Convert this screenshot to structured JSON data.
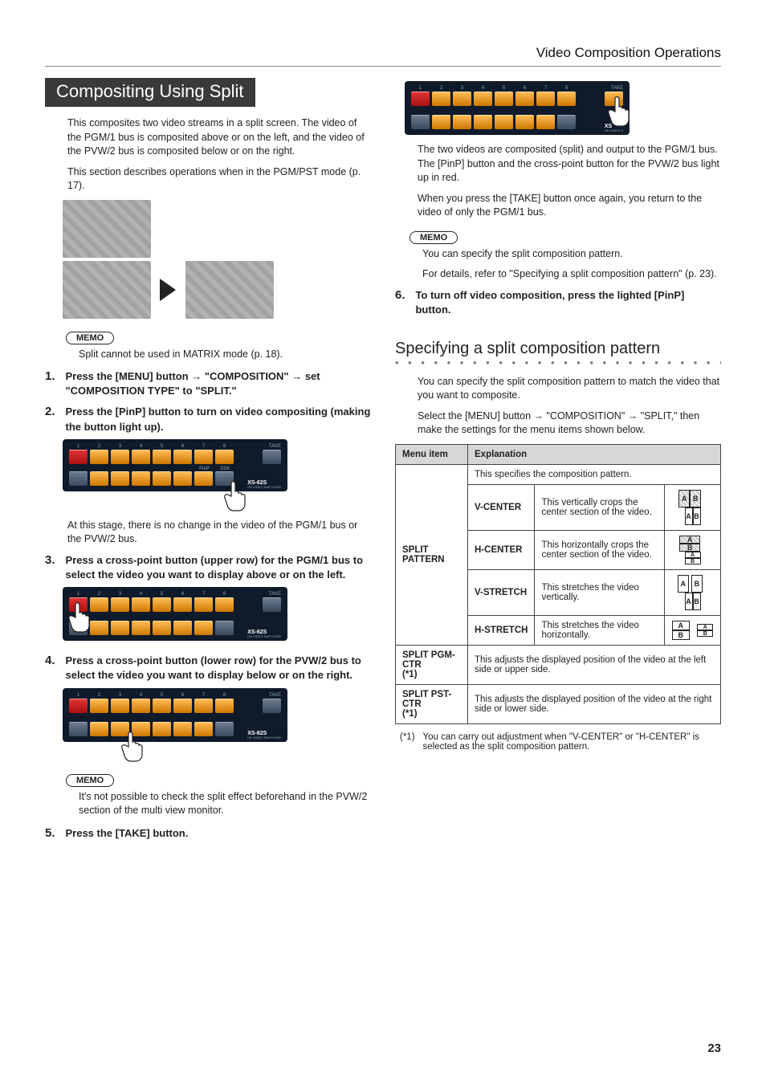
{
  "breadcrumb": "Video Composition Operations",
  "page_number": "23",
  "left": {
    "title": "Compositing Using Split",
    "intro1": "This composites two video streams in a split screen. The video of the PGM/1 bus is composited above or on the left, and the video of the PVW/2 bus is composited below or on the right.",
    "intro2": "This section describes operations when in the PGM/PST mode (p. 17).",
    "memo1_label": "MEMO",
    "memo1": "Split cannot be used in MATRIX mode (p. 18).",
    "step1_num": "1.",
    "step1": "Press the [MENU] button → \"COMPOSITION\" → set \"COMPOSITION TYPE\" to \"SPLIT.\"",
    "step2_num": "2.",
    "step2": "Press the [PinP] button to turn on video compositing (making the button light up).",
    "step2_after": "At this stage, there is no change in the video of the PGM/1 bus or the PVW/2 bus.",
    "step3_num": "3.",
    "step3": "Press a cross-point button (upper row) for the PGM/1 bus to select the video you want to display above or on the left.",
    "step4_num": "4.",
    "step4": "Press a cross-point button (lower row) for the PVW/2 bus to select the video you want to display below or on the right.",
    "memo2_label": "MEMO",
    "memo2": "It's not possible to check the split effect beforehand in the PVW/2 section of the multi view monitor.",
    "step5_num": "5.",
    "step5": "Press the [TAKE] button.",
    "device_label": "XS-62S",
    "device_sub": "HD VIDEO SWITCHER",
    "take_label": "TAKE",
    "pinp_label": "PinP",
    "dsk_label": "DSK"
  },
  "right": {
    "after_take1": "The two videos are composited (split) and output to the PGM/1 bus. The [PinP] button and the cross-point button for the PVW/2 bus light up in red.",
    "after_take2": "When you press the [TAKE] button once again, you return to the video of only the PGM/1 bus.",
    "memo3_label": "MEMO",
    "memo3_a": "You can specify the split composition pattern.",
    "memo3_b": "For details, refer to \"Specifying a split composition pattern\" (p. 23).",
    "step6_num": "6.",
    "step6": "To turn off video composition, press the lighted [PinP] button.",
    "h2": "Specifying a split composition pattern",
    "spec_intro1": "You can specify the split composition pattern to match the video that you want to composite.",
    "spec_intro2": "Select the [MENU] button → \"COMPOSITION\" → \"SPLIT,\" then make the settings for the menu items shown below.",
    "th_menu": "Menu item",
    "th_exp": "Explanation",
    "row_spec_intro": "This specifies the composition pattern.",
    "split_pattern": "SPLIT PATTERN",
    "vc_name": "V-CENTER",
    "vc_desc": "This vertically crops the center section of the video.",
    "hc_name": "H-CENTER",
    "hc_desc": "This horizontally crops the center section of the video.",
    "vs_name": "V-STRETCH",
    "vs_desc": "This stretches the video vertically.",
    "hs_name": "H-STRETCH",
    "hs_desc": "This stretches the video horizontally.",
    "pgm_ctr": "SPLIT PGM-CTR\n(*1)",
    "pgm_desc": "This adjusts the displayed position of the video at the left side or upper side.",
    "pst_ctr": "SPLIT PST-CTR\n(*1)",
    "pst_desc": "This adjusts the displayed position of the video at the right side or lower side.",
    "footnote_ref": "(*1)",
    "footnote": "You can carry out adjustment when \"V-CENTER\" or \"H-CENTER\" is selected as the split composition pattern."
  }
}
